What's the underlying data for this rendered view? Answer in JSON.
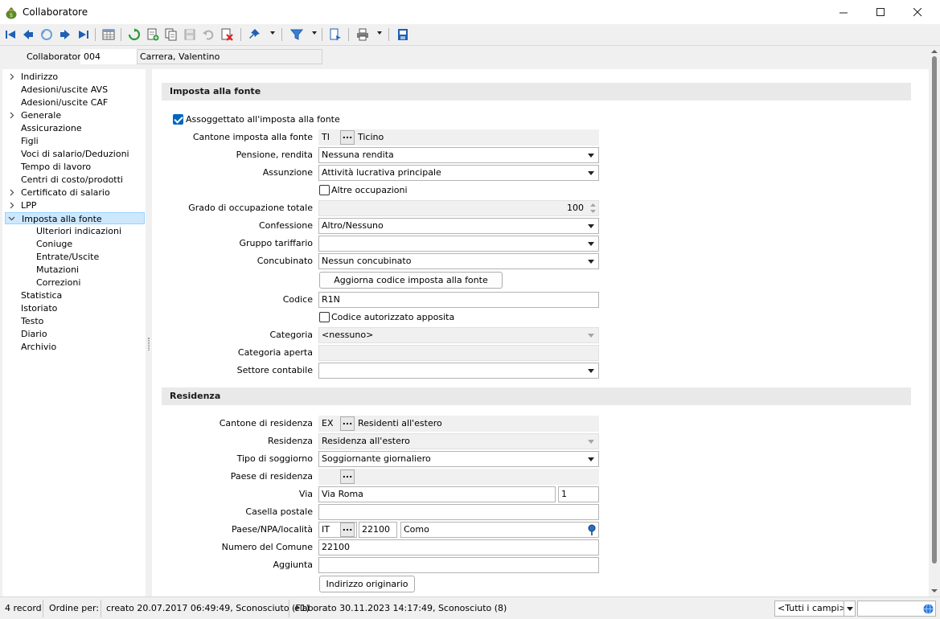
{
  "window": {
    "title": "Collaboratore",
    "app_icon": "money-bag-icon",
    "controls": [
      "minimize-icon",
      "maximize-icon",
      "close-icon"
    ]
  },
  "toolbar": {
    "icons": [
      "first-record-icon",
      "prev-record-icon",
      "undo-nav-icon",
      "next-record-icon",
      "last-record-icon",
      "table-view-icon",
      "refresh-icon",
      "new-record-icon",
      "copy-record-icon",
      "save-icon",
      "undo-icon",
      "delete-icon",
      "pin-icon",
      "filter-icon",
      "report-icon",
      "print-icon",
      "save-layout-icon"
    ]
  },
  "header": {
    "label": "Collaboratore",
    "code": "004",
    "name": "Carrera, Valentino"
  },
  "tree": {
    "items": [
      {
        "label": "Indirizzo",
        "level": 0,
        "chevron": "right"
      },
      {
        "label": "Adesioni/uscite AVS",
        "level": 0,
        "chevron": ""
      },
      {
        "label": "Adesioni/uscite CAF",
        "level": 0,
        "chevron": ""
      },
      {
        "label": "Generale",
        "level": 0,
        "chevron": "right"
      },
      {
        "label": "Assicurazione",
        "level": 0,
        "chevron": ""
      },
      {
        "label": "Figli",
        "level": 0,
        "chevron": ""
      },
      {
        "label": "Voci di salario/Deduzioni",
        "level": 0,
        "chevron": ""
      },
      {
        "label": "Tempo di lavoro",
        "level": 0,
        "chevron": ""
      },
      {
        "label": "Centri di costo/prodotti",
        "level": 0,
        "chevron": ""
      },
      {
        "label": "Certificato di salario",
        "level": 0,
        "chevron": "right"
      },
      {
        "label": "LPP",
        "level": 0,
        "chevron": "right"
      },
      {
        "label": "Imposta alla fonte",
        "level": 0,
        "chevron": "down",
        "selected": true
      },
      {
        "label": "Ulteriori indicazioni",
        "level": 1,
        "chevron": ""
      },
      {
        "label": "Coniuge",
        "level": 1,
        "chevron": ""
      },
      {
        "label": "Entrate/Uscite",
        "level": 1,
        "chevron": ""
      },
      {
        "label": "Mutazioni",
        "level": 1,
        "chevron": ""
      },
      {
        "label": "Correzioni",
        "level": 1,
        "chevron": ""
      },
      {
        "label": "Statistica",
        "level": 0,
        "chevron": ""
      },
      {
        "label": "Istoriato",
        "level": 0,
        "chevron": ""
      },
      {
        "label": "Testo",
        "level": 0,
        "chevron": ""
      },
      {
        "label": "Diario",
        "level": 0,
        "chevron": ""
      },
      {
        "label": "Archivio",
        "level": 0,
        "chevron": ""
      }
    ]
  },
  "imposta": {
    "section_title": "Imposta alla fonte",
    "assoggettato": {
      "label": "Assoggettato all'imposta alla fonte",
      "checked": true
    },
    "cantone_label": "Cantone imposta alla fonte",
    "cantone_code": "TI",
    "cantone_name": "Ticino",
    "pensione_label": "Pensione, rendita",
    "pensione_value": "Nessuna rendita",
    "assunzione_label": "Assunzione",
    "assunzione_value": "Attività lucrativa principale",
    "altre": {
      "label": "Altre occupazioni",
      "checked": false
    },
    "grado_label": "Grado di occupazione totale",
    "grado_value": "100",
    "confessione_label": "Confessione",
    "confessione_value": "Altro/Nessuno",
    "gruppo_label": "Gruppo tariffario",
    "gruppo_value": "",
    "concubinato_label": "Concubinato",
    "concubinato_value": "Nessun concubinato",
    "aggiorna_button": "Aggiorna codice imposta alla fonte",
    "codice_label": "Codice",
    "codice_value": "R1N",
    "codice_aut": {
      "label": "Codice autorizzato apposita",
      "checked": false
    },
    "categoria_label": "Categoria",
    "categoria_value": "<nessuno>",
    "categoria_aperta_label": "Categoria aperta",
    "categoria_aperta_value": "",
    "settore_label": "Settore contabile",
    "settore_value": ""
  },
  "residenza": {
    "section_title": "Residenza",
    "cantone_label": "Cantone di residenza",
    "cantone_code": "EX",
    "cantone_name": "Residenti all'estero",
    "residenza_label": "Residenza",
    "residenza_value": "Residenza all'estero",
    "soggiorno_label": "Tipo di soggiorno",
    "soggiorno_value": "Soggiornante giornaliero",
    "paese_label": "Paese di residenza",
    "paese_value": "",
    "via_label": "Via",
    "via_value": "Via Roma",
    "via_num": "1",
    "casella_label": "Casella postale",
    "casella_value": "",
    "npa_label": "Paese/NPA/località",
    "npa_country": "IT",
    "npa_zip": "22100",
    "npa_city": "Como",
    "comune_label": "Numero del Comune",
    "comune_value": "22100",
    "aggiunta_label": "Aggiunta",
    "aggiunta_value": "",
    "indirizzo_button": "Indirizzo originario"
  },
  "ellipsis": "...",
  "status": {
    "records": "4 record",
    "ordine": "Ordine per:",
    "creato": "creato 20.07.2017 06:49:49, Sconosciuto (F1)",
    "elaborato": "elaborato 30.11.2023 14:17:49, Sconosciuto (8)",
    "campi": "<Tutti i campi>"
  }
}
